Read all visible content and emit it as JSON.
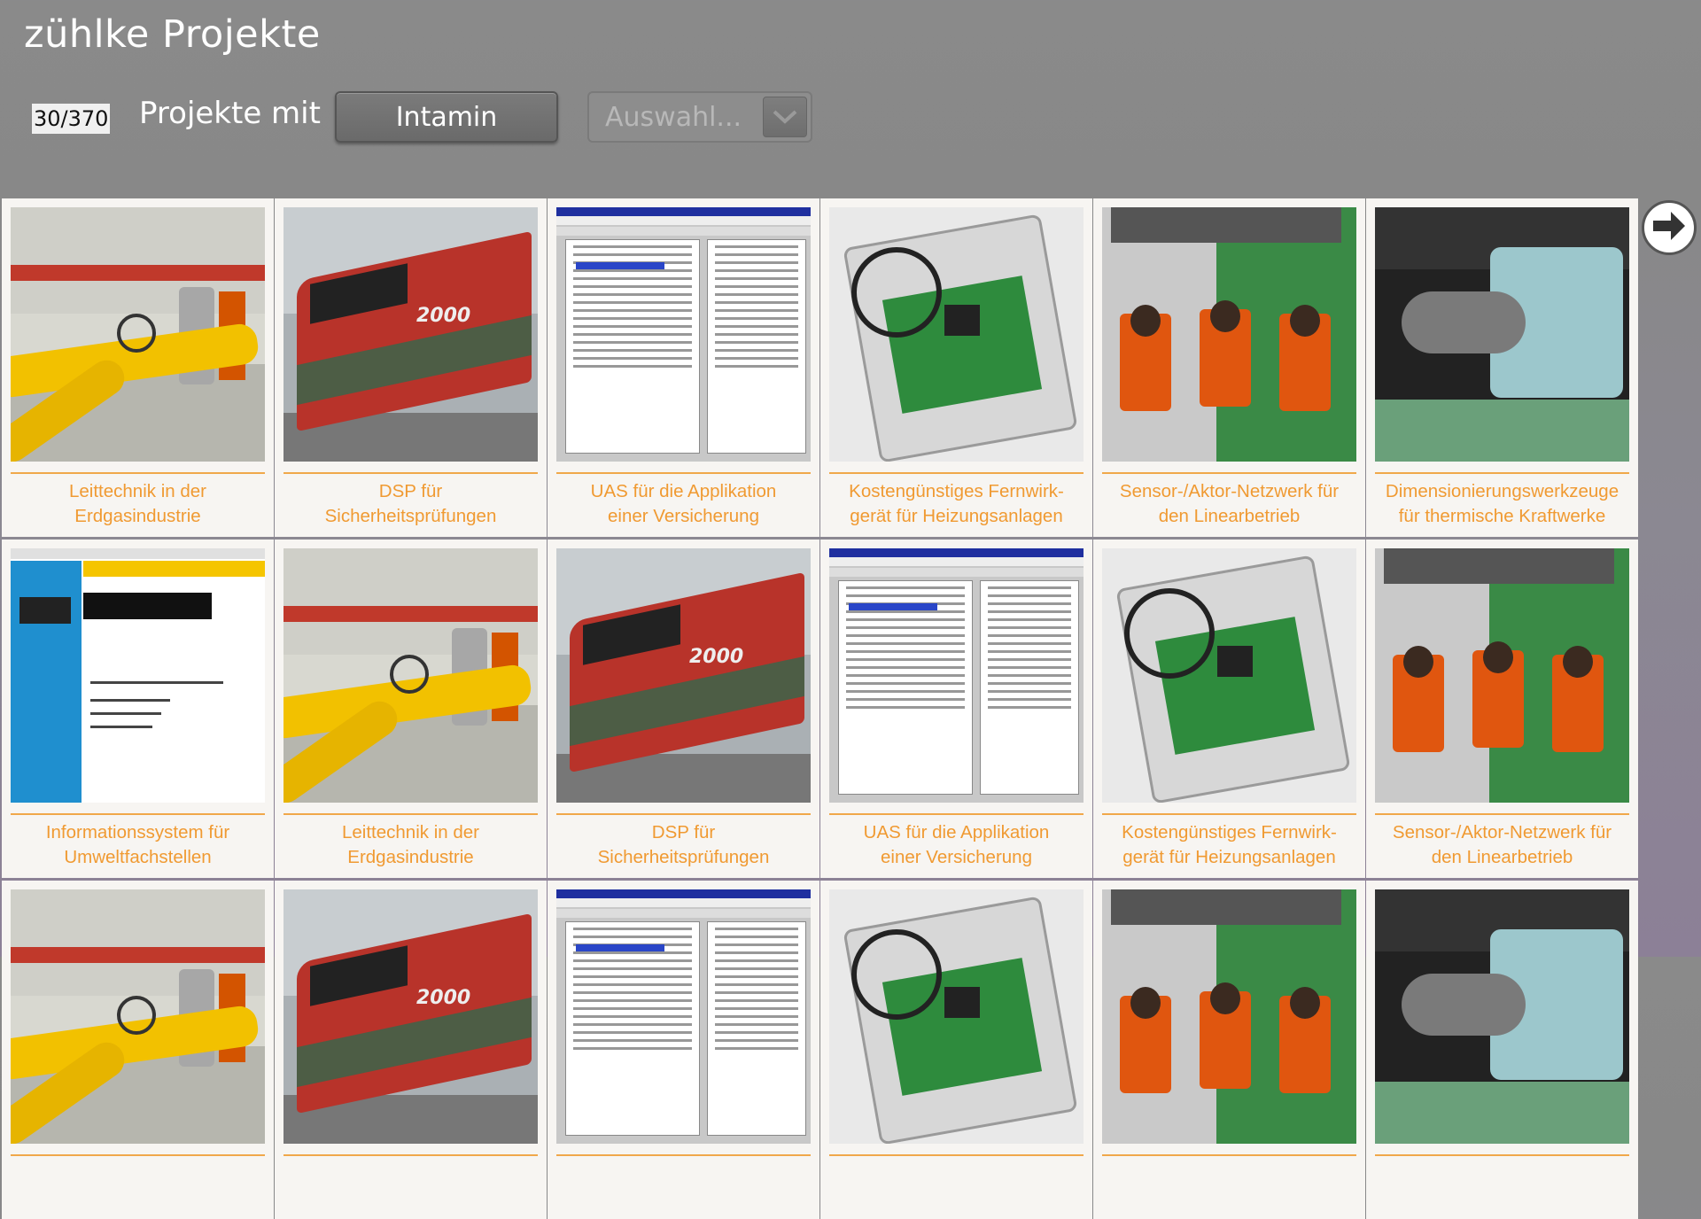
{
  "app": {
    "title": "zühlke Projekte"
  },
  "filter": {
    "counter": "30/370",
    "label": "Projekte mit",
    "value": "Intamin",
    "select_placeholder": "Auswahl..."
  },
  "icons": {
    "next": "arrow-right-icon",
    "dropdown": "chevron-down-icon"
  },
  "colors": {
    "caption": "#f09a32",
    "rule": "#f0a84a",
    "background": "#8a8a8a"
  },
  "projects": [
    {
      "caption_l1": "Leittechnik in der",
      "caption_l2": "Erdgasindustrie",
      "thumb": "gas"
    },
    {
      "caption_l1": "DSP für",
      "caption_l2": "Sicherheitsprüfungen",
      "thumb": "train"
    },
    {
      "caption_l1": "UAS für die Applikation",
      "caption_l2": "einer Versicherung",
      "thumb": "uas"
    },
    {
      "caption_l1": "Kostengünstiges Fernwirk-",
      "caption_l2": "gerät für Heizungsanlagen",
      "thumb": "box"
    },
    {
      "caption_l1": "Sensor-/Aktor-Netzwerk für",
      "caption_l2": "den Linearbetrieb",
      "thumb": "coaster"
    },
    {
      "caption_l1": "Dimensionierungswerkzeuge",
      "caption_l2": "für thermische Kraftwerke",
      "thumb": "turbine"
    },
    {
      "caption_l1": "Informationssystem für",
      "caption_l2": "Umweltfachstellen",
      "thumb": "web"
    },
    {
      "caption_l1": "Leittechnik in der",
      "caption_l2": "Erdgasindustrie",
      "thumb": "gas"
    },
    {
      "caption_l1": "DSP für",
      "caption_l2": "Sicherheitsprüfungen",
      "thumb": "train"
    },
    {
      "caption_l1": "UAS für die Applikation",
      "caption_l2": "einer Versicherung",
      "thumb": "uas"
    },
    {
      "caption_l1": "Kostengünstiges Fernwirk-",
      "caption_l2": "gerät für Heizungsanlagen",
      "thumb": "box"
    },
    {
      "caption_l1": "Sensor-/Aktor-Netzwerk für",
      "caption_l2": "den Linearbetrieb",
      "thumb": "coaster"
    },
    {
      "caption_l1": "",
      "caption_l2": "",
      "thumb": "gas"
    },
    {
      "caption_l1": "",
      "caption_l2": "",
      "thumb": "train"
    },
    {
      "caption_l1": "",
      "caption_l2": "",
      "thumb": "uas"
    },
    {
      "caption_l1": "",
      "caption_l2": "",
      "thumb": "box"
    },
    {
      "caption_l1": "",
      "caption_l2": "",
      "thumb": "coaster"
    },
    {
      "caption_l1": "",
      "caption_l2": "",
      "thumb": "turbine"
    }
  ]
}
